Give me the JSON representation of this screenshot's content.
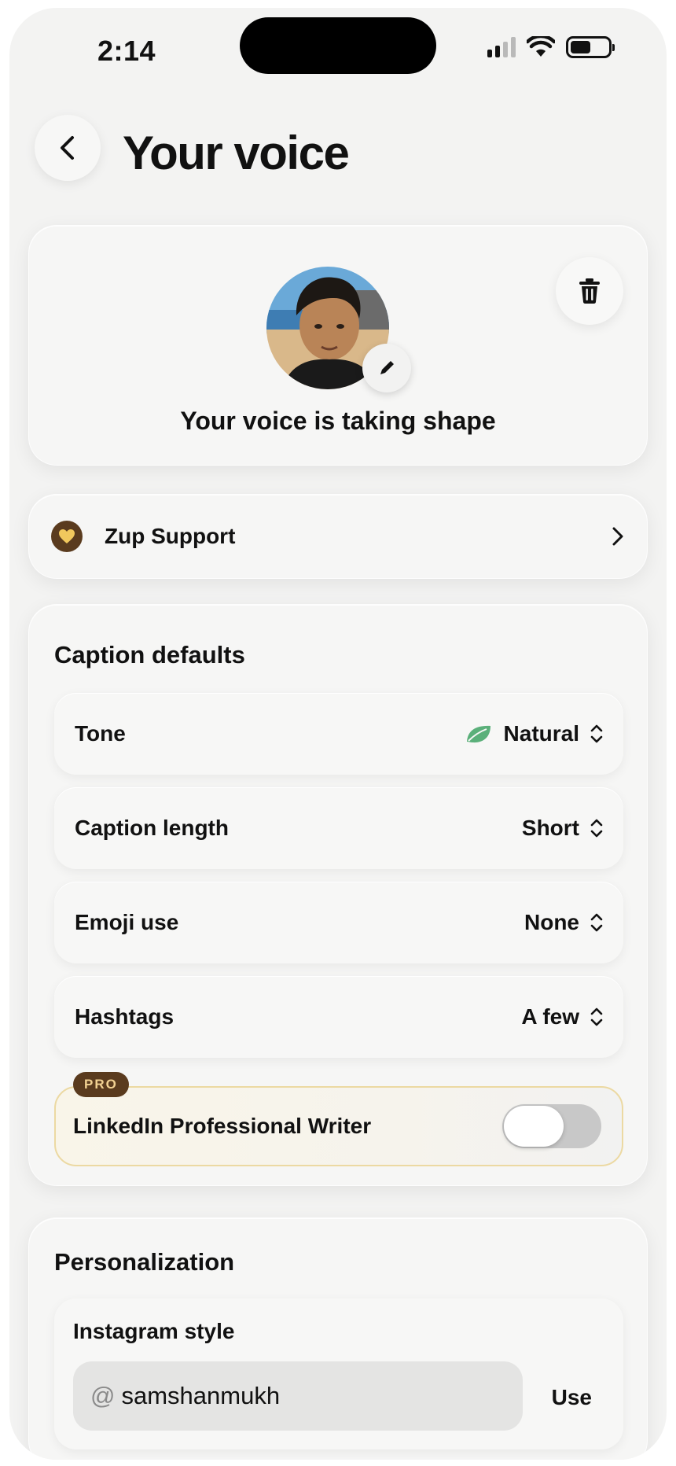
{
  "status_bar": {
    "time": "2:14"
  },
  "header": {
    "title": "Your voice"
  },
  "profile": {
    "subtitle": "Your voice is taking shape"
  },
  "support": {
    "label": "Zup Support"
  },
  "caption_defaults": {
    "title": "Caption defaults",
    "rows": [
      {
        "label": "Tone",
        "value": "Natural",
        "icon": "leaf-icon"
      },
      {
        "label": "Caption length",
        "value": "Short"
      },
      {
        "label": "Emoji use",
        "value": "None"
      },
      {
        "label": "Hashtags",
        "value": "A few"
      }
    ],
    "pro": {
      "badge": "PRO",
      "label": "LinkedIn Professional Writer",
      "enabled": false
    }
  },
  "personalization": {
    "title": "Personalization",
    "instagram": {
      "label": "Instagram style",
      "prefix": "@",
      "value": "samshanmukh",
      "use_label": "Use"
    }
  },
  "colors": {
    "pro_brown": "#5a3b1e",
    "leaf_green": "#5bb07a",
    "pro_border": "#ecd9a2"
  }
}
